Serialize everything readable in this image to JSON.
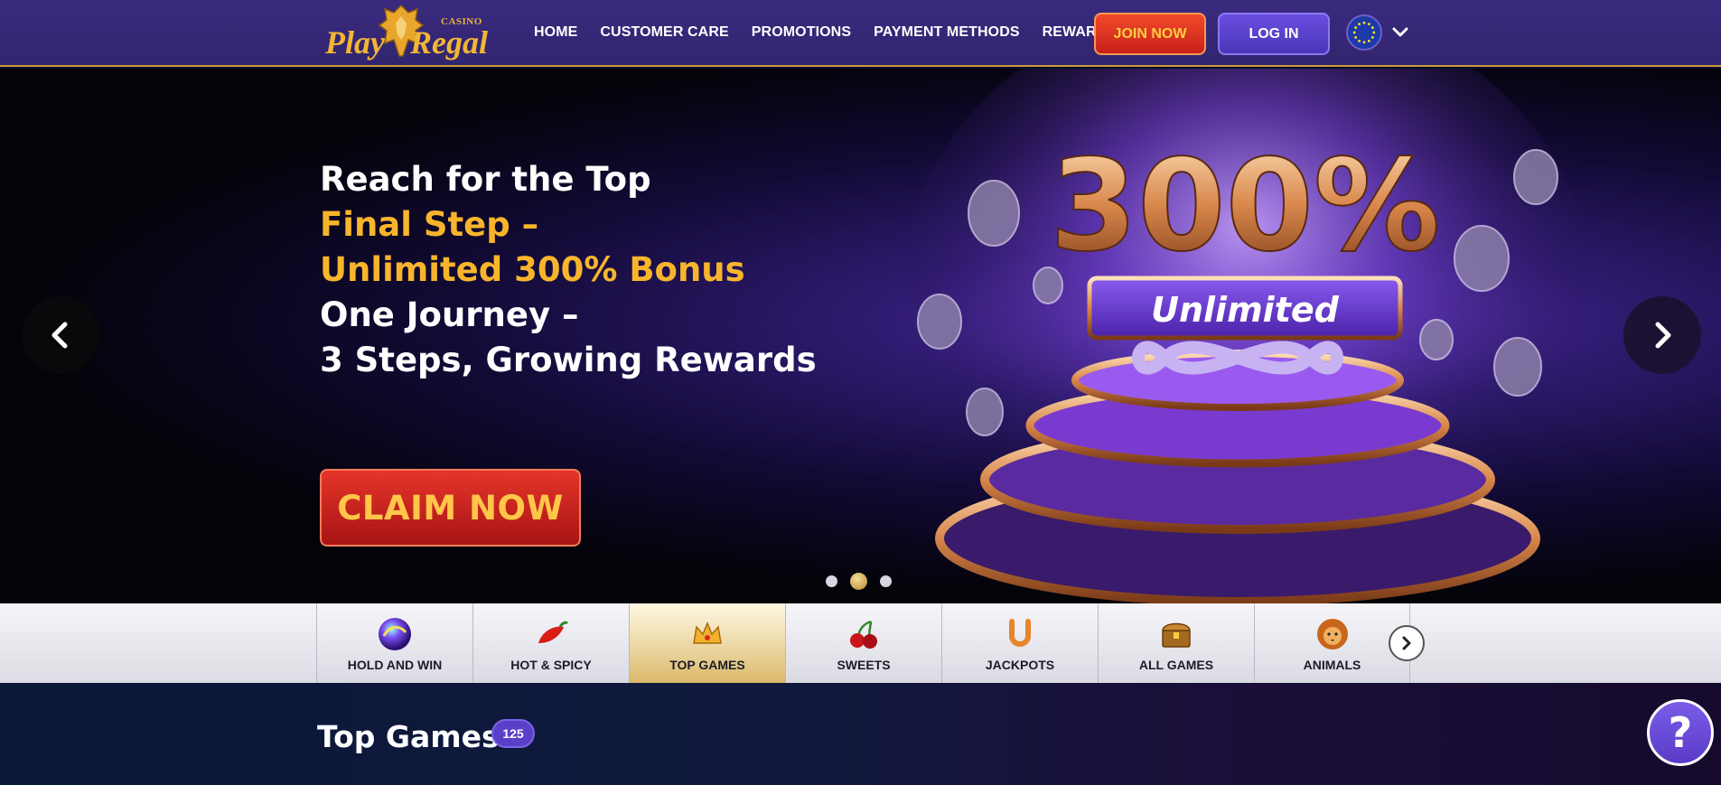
{
  "brand": {
    "casino": "CASINO",
    "play": "Play",
    "regal": "Regal"
  },
  "nav": {
    "items": [
      "HOME",
      "CUSTOMER CARE",
      "PROMOTIONS",
      "PAYMENT METHODS",
      "REWARDS"
    ]
  },
  "auth": {
    "join": "JOIN NOW",
    "login": "LOG IN"
  },
  "hero": {
    "line1": "Reach for the Top",
    "line2": "Final Step –",
    "line3": "Unlimited 300% Bonus",
    "line4": "One Journey –",
    "line5": "3 Steps, Growing Rewards",
    "cta": "CLAIM NOW",
    "art_big": "300%",
    "art_banner": "Unlimited",
    "slides": 3,
    "active_slide": 2
  },
  "categories": [
    {
      "label": "HOLD AND WIN",
      "icon": "orb-icon"
    },
    {
      "label": "HOT & SPICY",
      "icon": "chili-icon"
    },
    {
      "label": "TOP GAMES",
      "icon": "crown-icon"
    },
    {
      "label": "SWEETS",
      "icon": "cherry-icon"
    },
    {
      "label": "JACKPOTS",
      "icon": "horseshoe-icon"
    },
    {
      "label": "ALL GAMES",
      "icon": "treasure-chest-icon"
    },
    {
      "label": "ANIMALS",
      "icon": "lion-icon"
    }
  ],
  "active_category": "TOP GAMES",
  "section": {
    "title": "Top Games",
    "count": "125"
  },
  "help": {
    "label": "?"
  },
  "colors": {
    "header": "#3a2a7e",
    "gold": "#f8b52c",
    "accent_red": "#d9281e",
    "accent_purple": "#5a3fc8"
  }
}
